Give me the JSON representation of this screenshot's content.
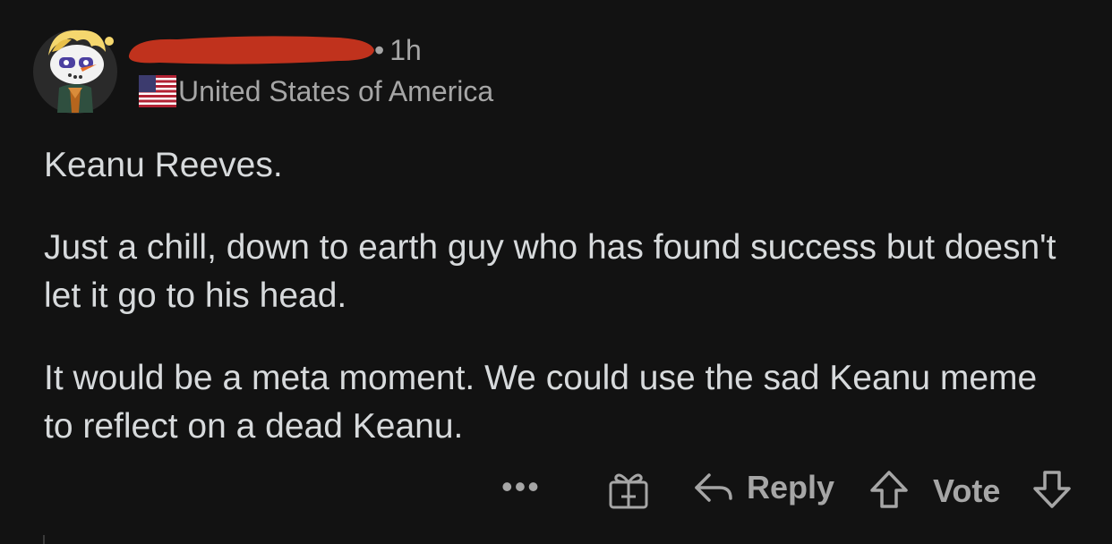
{
  "comment": {
    "timestamp": "1h",
    "separator": "•",
    "flair": "United States of America",
    "flair_icon": "us-flag-icon",
    "paragraphs": [
      "Keanu Reeves.",
      "Just a chill, down to earth guy who has found success but doesn't let it go to his head.",
      "It would be a meta moment. We could use the sad Keanu meme to reflect on a dead Keanu."
    ]
  },
  "actions": {
    "more_label": "•••",
    "reply_label": "Reply",
    "vote_label": "Vote",
    "icons": [
      "more-icon",
      "gift-icon",
      "reply-arrow-icon",
      "upvote-icon",
      "downvote-icon"
    ]
  },
  "colors": {
    "background": "#121212",
    "text": "#d7dadc",
    "meta": "#a6a6a6",
    "redaction": "#c0321d"
  }
}
